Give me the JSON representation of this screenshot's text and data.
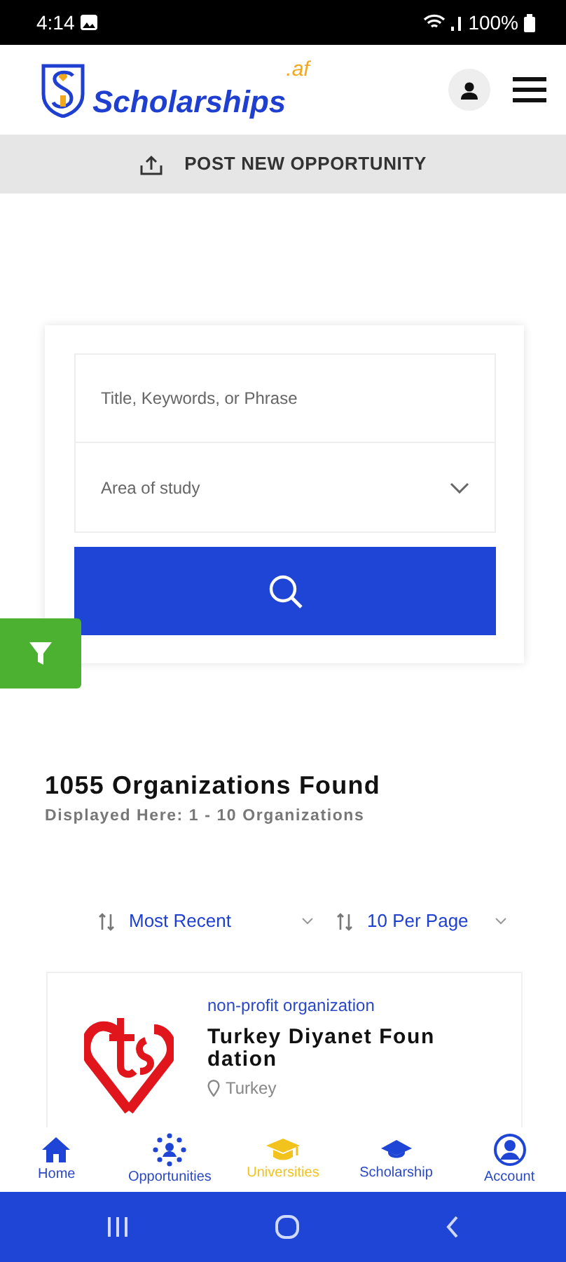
{
  "status_bar": {
    "time": "4:14",
    "battery": "100%"
  },
  "header": {
    "logo_text": "Scholarships",
    "logo_suffix": ".af"
  },
  "post_button": {
    "label": "POST NEW OPPORTUNITY"
  },
  "search": {
    "keyword_placeholder": "Title, Keywords, or Phrase",
    "area_placeholder": "Area of study"
  },
  "results": {
    "title": "1055 Organizations Found",
    "subtitle": "Displayed Here: 1 - 10 Organizations"
  },
  "sort": {
    "order": "Most Recent",
    "per_page": "10 Per Page"
  },
  "organizations": [
    {
      "type": "non-profit organization",
      "name": "Turkey Diyanet Foun dation",
      "location": "Turkey"
    }
  ],
  "bottom_nav": [
    {
      "label": "Home",
      "selected": false
    },
    {
      "label": "Opportunities",
      "selected": false
    },
    {
      "label": "Universities",
      "selected": true
    },
    {
      "label": "Scholarship",
      "selected": false
    },
    {
      "label": "Account",
      "selected": false
    }
  ]
}
